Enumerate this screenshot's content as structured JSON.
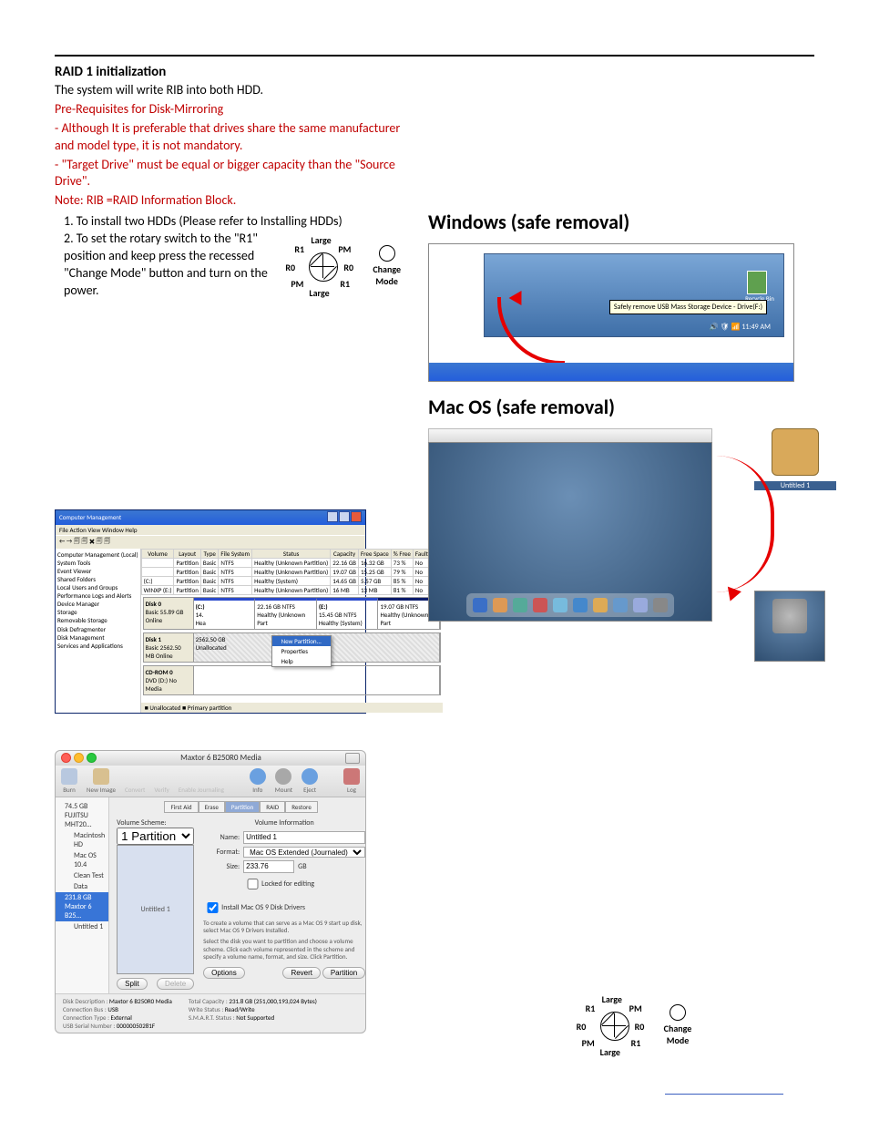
{
  "section_title": "RAID 1 initialization",
  "intro": "The system will write RIB into both HDD.",
  "red_lines": [
    "Pre-Requisites for Disk-Mirroring",
    "- Although It is preferable that drives share the same manufacturer and model type, it is not mandatory.",
    "- \"Target Drive\" must be equal or bigger capacity than the \"Source Drive\".",
    "Note: RIB =RAID Information Block."
  ],
  "steps": [
    "1. To install two HDDs (Please refer to Installing HDDs)",
    "2. To set the rotary switch to the \"R1\" position and keep press the recessed \"Change Mode\" button and turn on the power."
  ],
  "rotary": {
    "large_top": "Large",
    "large_bottom": "Large",
    "r1_tl": "R1",
    "pm_tr": "PM",
    "r0_l": "R0",
    "r0_r": "R0",
    "pm_bl": "PM",
    "r1_br": "R1",
    "change": "Change",
    "mode": "Mode"
  },
  "win_heading": "Windows (safe removal)",
  "mac_heading": "Mac OS (safe removal)",
  "win_safe_shot": {
    "balloon": "Safely remove USB Mass Storage Device - Drive(F:)",
    "recycle": "Recycle Bin",
    "clock": "11:49 AM"
  },
  "mac_drive_label": "Untitled 1",
  "cm": {
    "title": "Computer Management",
    "menu": "File   Action   View   Window   Help",
    "tree": [
      "Computer Management (Local)",
      "  System Tools",
      "    Event Viewer",
      "    Shared Folders",
      "    Local Users and Groups",
      "    Performance Logs and Alerts",
      "    Device Manager",
      "  Storage",
      "    Removable Storage",
      "    Disk Defragmenter",
      "    Disk Management",
      "  Services and Applications"
    ],
    "table_headers": [
      "Volume",
      "Layout",
      "Type",
      "File System",
      "Status",
      "Capacity",
      "Free Space",
      "% Free",
      "Fault Tole"
    ],
    "table_rows": [
      [
        "",
        "Partition",
        "Basic",
        "NTFS",
        "Healthy (Unknown Partition)",
        "22.16 GB",
        "16.32 GB",
        "73 %",
        "No"
      ],
      [
        "",
        "Partition",
        "Basic",
        "NTFS",
        "Healthy (Unknown Partition)",
        "19.07 GB",
        "15.25 GB",
        "79 %",
        "No"
      ],
      [
        "(C:)",
        "Partition",
        "Basic",
        "NTFS",
        "Healthy (System)",
        "14.65 GB",
        "5.57 GB",
        "85 %",
        "No"
      ],
      [
        "WINXP (E:)",
        "Partition",
        "Basic",
        "NTFS",
        "Healthy (Unknown Partition)",
        "16 MB",
        "13 MB",
        "81 %",
        "No"
      ]
    ],
    "disks": [
      {
        "name": "Disk 0",
        "sub": "Basic\n55.89 GB\nOnline",
        "parts": [
          {
            "cls": "blue",
            "t1": "(C:)",
            "t2": "14.",
            "t3": "Hea"
          },
          {
            "cls": "blue",
            "t1": "",
            "t2": "22.16 GB NTFS",
            "t3": "Healthy (Unknown Part"
          },
          {
            "cls": "blue",
            "t1": "(E:)",
            "t2": "15.45 GB NTFS",
            "t3": "Healthy (System)"
          },
          {
            "cls": "navy",
            "t1": "",
            "t2": "19.07 GB NTFS",
            "t3": "Healthy (Unknown Part"
          }
        ]
      },
      {
        "name": "Disk 1",
        "sub": "Basic\n2562.50 MB\nOnline",
        "parts": [
          {
            "cls": "unalloc",
            "t1": "",
            "t2": "2562.50 GB",
            "t3": "Unallocated"
          }
        ]
      },
      {
        "name": "CD-ROM 0",
        "sub": "DVD (D:)\n\nNo Media",
        "parts": []
      }
    ],
    "ctx": [
      "New Partition...",
      "Properties",
      "Help"
    ],
    "legend": "■ Unallocated  ■ Primary partition"
  },
  "du": {
    "title": "Maxtor 6 B250R0 Media",
    "toolbar": [
      "Burn",
      "New Image",
      "Convert",
      "Verify",
      "Enable Journaling",
      "Info",
      "Mount",
      "Eject",
      "Log"
    ],
    "side": [
      {
        "t": "74.5 GB FUJITSU MHT20…"
      },
      {
        "t": "Macintosh HD",
        "sub": true
      },
      {
        "t": "Mac OS 10.4",
        "sub": true
      },
      {
        "t": "Clean Test",
        "sub": true
      },
      {
        "t": "Data",
        "sub": true
      },
      {
        "t": "231.8 GB Maxtor 6 B25…",
        "sel": true
      },
      {
        "t": "Untitled 1",
        "sub": true
      }
    ],
    "tabs": [
      "First Aid",
      "Erase",
      "Partition",
      "RAID",
      "Restore"
    ],
    "tab_selected": "Partition",
    "vscheme_label": "Volume Scheme:",
    "vscheme_select": "1 Partition",
    "vscheme_bar": "Untitled 1",
    "vinfo_label": "Volume Information",
    "name_lab": "Name:",
    "name_val": "Untitled 1",
    "format_lab": "Format:",
    "format_val": "Mac OS Extended (Journaled)",
    "size_lab": "Size:",
    "size_val": "233.76",
    "size_unit": "GB",
    "locked": "Locked for editing",
    "install9": "Install Mac OS 9 Disk Drivers",
    "note1": "To create a volume that can serve as a Mac OS 9 start up disk, select Mac OS 9 Drivers Installed.",
    "note2": "Select the disk you want to partition and choose a volume scheme. Click each volume represented in the scheme and specify a volume name, format, and size. Click Partition.",
    "btns_left": [
      "Split",
      "Delete"
    ],
    "btns_right": [
      "Options",
      "Revert",
      "Partition"
    ],
    "footer": [
      [
        "Disk Description :",
        "Maxtor 6 B250R0 Media"
      ],
      [
        "Connection Bus :",
        "USB"
      ],
      [
        "Connection Type :",
        "External"
      ],
      [
        "USB Serial Number :",
        "00000050281F"
      ],
      [
        "Total Capacity :",
        "231.8 GB (251,000,193,024 Bytes)"
      ],
      [
        "Write Status :",
        "Read/Write"
      ],
      [
        "S.M.A.R.T. Status :",
        "Not Supported"
      ]
    ]
  }
}
